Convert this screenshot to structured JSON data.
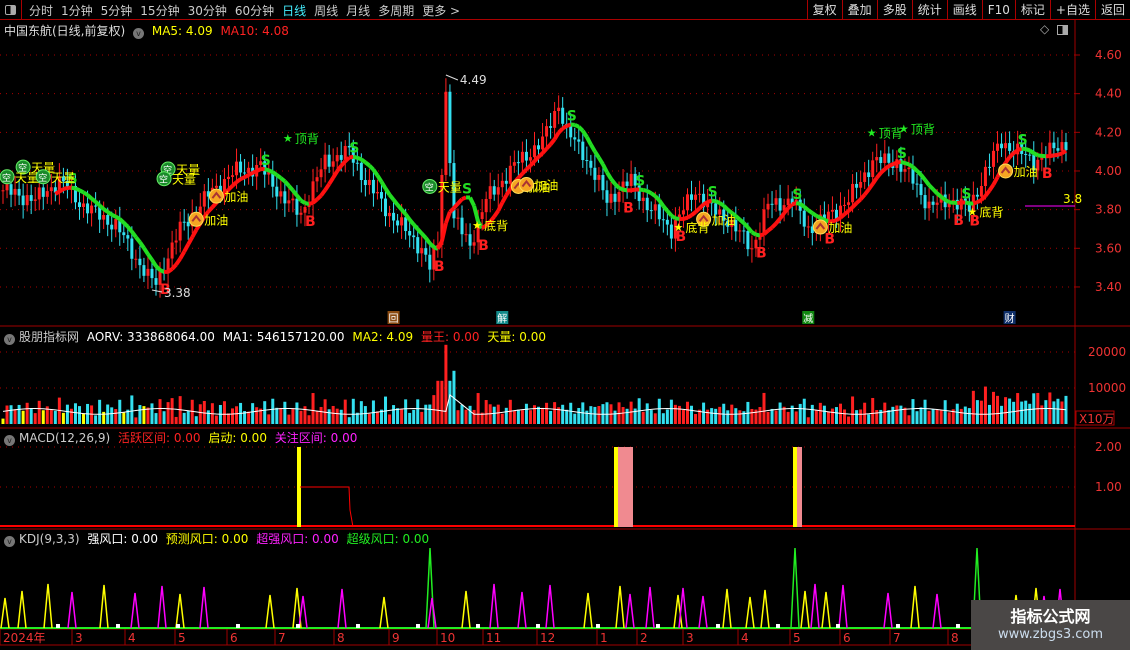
{
  "toolbar": {
    "periods": [
      "分时",
      "1分钟",
      "5分钟",
      "15分钟",
      "30分钟",
      "60分钟",
      "日线",
      "周线",
      "月线",
      "多周期",
      "更多 >"
    ],
    "active_period": "日线",
    "actions": [
      "复权",
      "叠加",
      "多股",
      "统计",
      "画线",
      "F10",
      "标记",
      "+自选",
      "返回"
    ]
  },
  "main": {
    "title": "中国东航(日线,前复权)",
    "ma5": "MA5: 4.09",
    "ma10": "MA10: 4.08",
    "y_ticks": [
      "4.60",
      "4.40",
      "4.20",
      "4.00",
      "3.80",
      "3.60",
      "3.40"
    ],
    "y_values": [
      4.6,
      4.4,
      4.2,
      4.0,
      3.8,
      3.6,
      3.4
    ],
    "high_label": "4.49",
    "low_label": "3.38",
    "last_label": "3.8",
    "price_path": [
      [
        0,
        3.9
      ],
      [
        8,
        3.85
      ],
      [
        14,
        3.95
      ],
      [
        20,
        3.82
      ],
      [
        28,
        3.72
      ],
      [
        36,
        3.45
      ],
      [
        38,
        3.42
      ],
      [
        44,
        3.7
      ],
      [
        52,
        3.9
      ],
      [
        58,
        4.0
      ],
      [
        64,
        4.02
      ],
      [
        70,
        3.85
      ],
      [
        74,
        3.78
      ],
      [
        80,
        4.05
      ],
      [
        86,
        4.1
      ],
      [
        90,
        3.95
      ],
      [
        96,
        3.78
      ],
      [
        104,
        3.6
      ],
      [
        106,
        3.5
      ],
      [
        108,
        3.62
      ],
      [
        110,
        4.4
      ],
      [
        112,
        3.75
      ],
      [
        116,
        3.62
      ],
      [
        120,
        3.85
      ],
      [
        128,
        4.05
      ],
      [
        134,
        4.15
      ],
      [
        138,
        4.35
      ],
      [
        140,
        4.2
      ],
      [
        144,
        4.1
      ],
      [
        150,
        3.85
      ],
      [
        156,
        3.95
      ],
      [
        160,
        3.82
      ],
      [
        166,
        3.7
      ],
      [
        172,
        3.9
      ],
      [
        176,
        3.8
      ],
      [
        180,
        3.75
      ],
      [
        186,
        3.6
      ],
      [
        190,
        3.82
      ],
      [
        196,
        3.85
      ],
      [
        200,
        3.7
      ],
      [
        204,
        3.75
      ],
      [
        210,
        3.85
      ],
      [
        216,
        4.05
      ],
      [
        222,
        4.05
      ],
      [
        226,
        3.95
      ],
      [
        230,
        3.82
      ],
      [
        236,
        3.85
      ],
      [
        240,
        3.8
      ],
      [
        244,
        4.0
      ],
      [
        248,
        4.15
      ],
      [
        252,
        4.1
      ],
      [
        256,
        4.05
      ],
      [
        260,
        4.1
      ],
      [
        264,
        4.15
      ]
    ],
    "annotations": [
      {
        "t": "天量",
        "type": "kong",
        "i": 5,
        "p": 4.02
      },
      {
        "t": "天量",
        "type": "kong",
        "i": 1,
        "p": 3.97
      },
      {
        "t": "天量",
        "type": "kong",
        "i": 10,
        "p": 3.97
      },
      {
        "t": "天量",
        "type": "kong",
        "i": 41,
        "p": 4.01
      },
      {
        "t": "天量",
        "type": "kong",
        "i": 40,
        "p": 3.96
      },
      {
        "t": "天量",
        "type": "kong",
        "i": 106,
        "p": 3.92
      },
      {
        "t": "加油",
        "type": "oil",
        "i": 53,
        "p": 3.87
      },
      {
        "t": "加油",
        "type": "oil",
        "i": 48,
        "p": 3.75
      },
      {
        "t": "加油",
        "type": "oil",
        "i": 128,
        "p": 3.92
      },
      {
        "t": "加油",
        "type": "oil",
        "i": 130,
        "p": 3.93
      },
      {
        "t": "加油",
        "type": "oil",
        "i": 174,
        "p": 3.75
      },
      {
        "t": "加油",
        "type": "oil",
        "i": 203,
        "p": 3.71
      },
      {
        "t": "加油",
        "type": "oil",
        "i": 249,
        "p": 4.0
      },
      {
        "t": "顶背",
        "type": "star",
        "i": 71,
        "p": 4.17
      },
      {
        "t": "顶背",
        "type": "star",
        "i": 216,
        "p": 4.2
      },
      {
        "t": "顶背",
        "type": "star",
        "i": 224,
        "p": 4.22
      },
      {
        "t": "底背",
        "type": "star",
        "i": 118,
        "p": 3.72
      },
      {
        "t": "底背",
        "type": "star",
        "i": 168,
        "p": 3.71
      },
      {
        "t": "底背",
        "type": "star",
        "i": 241,
        "p": 3.79
      }
    ],
    "signal_boxes": [
      {
        "t": "回",
        "color": "#8a4a10",
        "i": 97
      },
      {
        "t": "解",
        "color": "#128a8a",
        "i": 124
      },
      {
        "t": "减",
        "color": "#118811",
        "i": 200
      },
      {
        "t": "财",
        "color": "#10306a",
        "i": 250
      }
    ]
  },
  "volume": {
    "title": "股朋指标网",
    "aorv": "AORV: 333868064.00",
    "ma1": "MA1: 546157120.00",
    "ma2": "MA2: 4.09",
    "xingwang": "量王: 0.00",
    "tianliang": "天量: 0.00",
    "y_ticks": [
      "20000",
      "10000"
    ],
    "unit": "X10万"
  },
  "macd": {
    "title": "MACD(12,26,9)",
    "active": "活跃区间: 0.00",
    "start": "启动: 0.00",
    "focus": "关注区间: 0.00",
    "y_ticks": [
      "2.00",
      "1.00"
    ]
  },
  "kdj": {
    "title": "KDJ(9,3,3)",
    "strong": "强风口: 0.00",
    "predict": "预测风口: 0.00",
    "super_strong": "超强风口: 0.00",
    "super": "超级风口: 0.00"
  },
  "date_axis": [
    "2024年",
    "3",
    "4",
    "5",
    "6",
    "7",
    "8",
    "9",
    "10",
    "11",
    "12",
    "1",
    "2",
    "3",
    "4",
    "5",
    "6",
    "7",
    "8"
  ],
  "watermark": {
    "line1": "指标公式网",
    "line2": "www.zbgs3.com"
  },
  "colors": {
    "up": "#ff2020",
    "down": "#33e0f0",
    "grid": "#a00000",
    "ma_up": "#ff1010",
    "ma_down": "#22dd22"
  }
}
